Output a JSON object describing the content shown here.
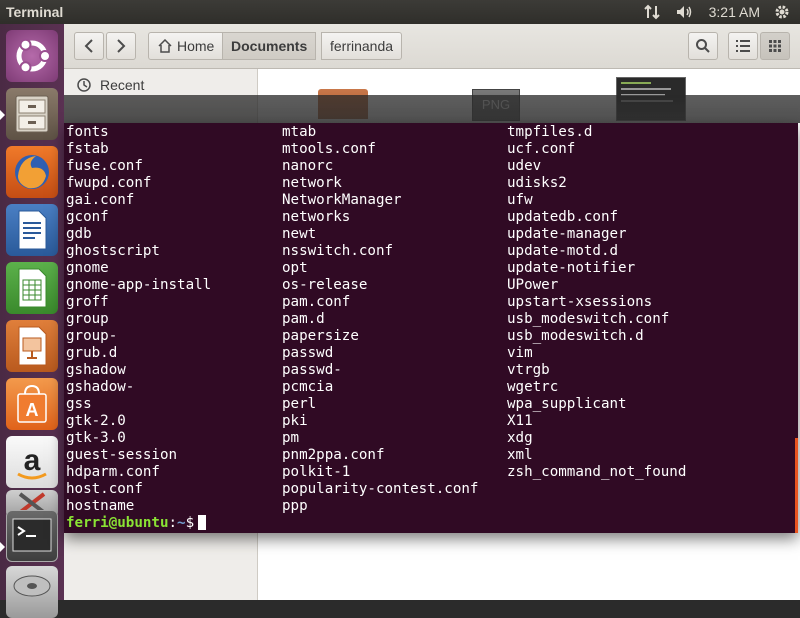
{
  "top_panel": {
    "title": "Terminal",
    "time": "3:21 AM"
  },
  "launcher": {
    "items": [
      {
        "name": "dash-button",
        "icon": "ubuntu-logo-icon"
      },
      {
        "name": "files-launcher",
        "icon": "file-cabinet-icon"
      },
      {
        "name": "firefox-launcher",
        "icon": "firefox-icon"
      },
      {
        "name": "writer-launcher",
        "icon": "writer-document-icon"
      },
      {
        "name": "calc-launcher",
        "icon": "spreadsheet-icon"
      },
      {
        "name": "impress-launcher",
        "icon": "presentation-icon"
      },
      {
        "name": "software-center-launcher",
        "icon": "shopping-bag-icon"
      },
      {
        "name": "amazon-launcher",
        "icon": "amazon-icon"
      },
      {
        "name": "settings-launcher",
        "icon": "tools-icon"
      },
      {
        "name": "terminal-launcher",
        "icon": "terminal-icon"
      },
      {
        "name": "disk-launcher",
        "icon": "disk-icon"
      }
    ]
  },
  "files": {
    "home_label": "Home",
    "crumbs": [
      "Documents",
      "ferrinanda"
    ],
    "sidebar": {
      "recent": "Recent"
    },
    "thumb_png": "PNG"
  },
  "terminal": {
    "col1": [
      "fonts",
      "fstab",
      "fuse.conf",
      "fwupd.conf",
      "gai.conf",
      "gconf",
      "gdb",
      "ghostscript",
      "gnome",
      "gnome-app-install",
      "groff",
      "group",
      "group-",
      "grub.d",
      "gshadow",
      "gshadow-",
      "gss",
      "gtk-2.0",
      "gtk-3.0",
      "guest-session",
      "hdparm.conf",
      "host.conf",
      "hostname"
    ],
    "col2": [
      "mtab",
      "mtools.conf",
      "nanorc",
      "network",
      "NetworkManager",
      "networks",
      "newt",
      "nsswitch.conf",
      "opt",
      "os-release",
      "pam.conf",
      "pam.d",
      "papersize",
      "passwd",
      "passwd-",
      "pcmcia",
      "perl",
      "pki",
      "pm",
      "pnm2ppa.conf",
      "polkit-1",
      "popularity-contest.conf",
      "ppp"
    ],
    "col3": [
      "tmpfiles.d",
      "ucf.conf",
      "udev",
      "udisks2",
      "ufw",
      "updatedb.conf",
      "update-manager",
      "update-motd.d",
      "update-notifier",
      "UPower",
      "upstart-xsessions",
      "usb_modeswitch.conf",
      "usb_modeswitch.d",
      "vim",
      "vtrgb",
      "wgetrc",
      "wpa_supplicant",
      "X11",
      "xdg",
      "xml",
      "zsh_command_not_found"
    ],
    "prompt_user": "ferri@ubuntu",
    "prompt_sep": ":",
    "prompt_path": "~",
    "prompt_sym": "$"
  },
  "colors": {
    "terminal_bg": "#300a24",
    "prompt_user": "#8ae234",
    "prompt_path": "#729fcf",
    "accent": "#e95420"
  }
}
